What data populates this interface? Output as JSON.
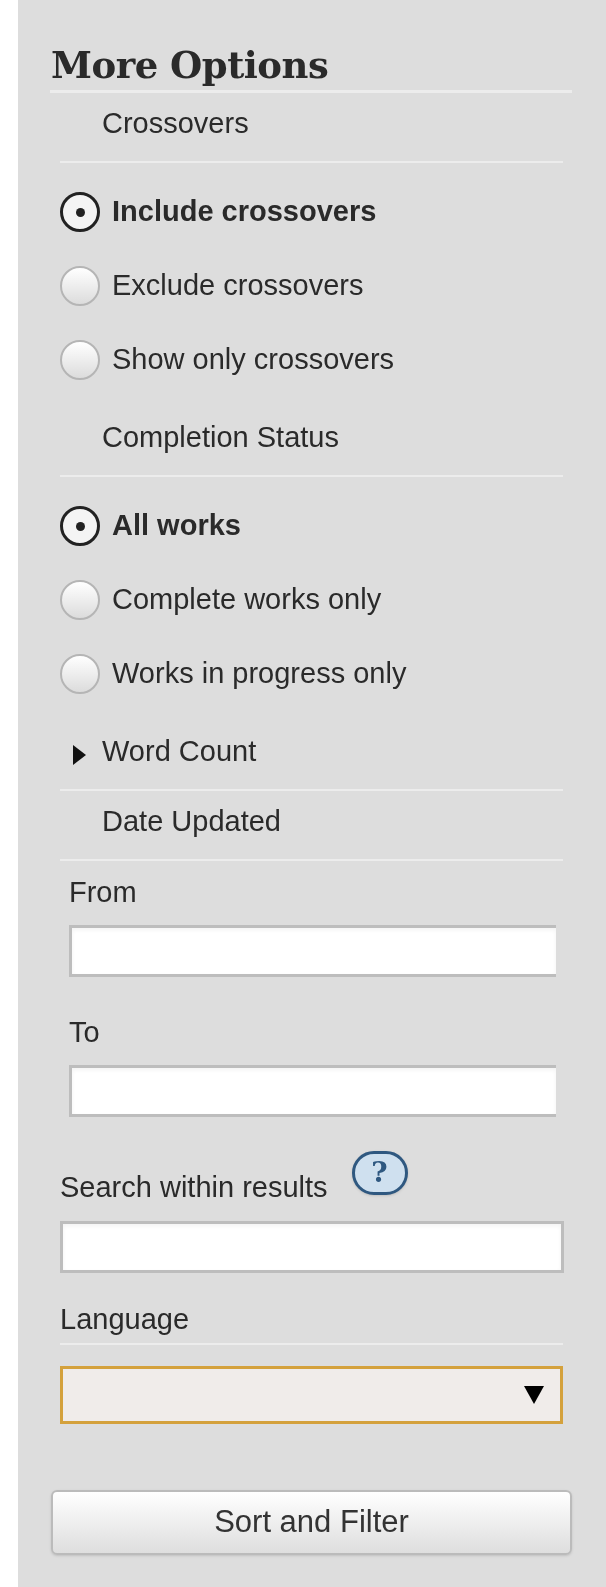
{
  "heading": "More Options",
  "sections": [
    {
      "kind": "radio_group",
      "title": "Crossovers",
      "options": [
        {
          "label": "Include crossovers",
          "selected": true
        },
        {
          "label": "Exclude crossovers",
          "selected": false
        },
        {
          "label": "Show only crossovers",
          "selected": false
        }
      ]
    },
    {
      "kind": "radio_group",
      "title": "Completion Status",
      "options": [
        {
          "label": "All works",
          "selected": true
        },
        {
          "label": "Complete works only",
          "selected": false
        },
        {
          "label": "Works in progress only",
          "selected": false
        }
      ]
    },
    {
      "kind": "collapsible",
      "title": "Word Count",
      "expanded": false
    },
    {
      "kind": "date_range",
      "title": "Date Updated",
      "fields": [
        {
          "label": "From"
        },
        {
          "label": "To"
        }
      ]
    }
  ],
  "search": {
    "label": "Search within results",
    "help": "?"
  },
  "language": {
    "label": "Language"
  },
  "submit": "Sort and Filter"
}
